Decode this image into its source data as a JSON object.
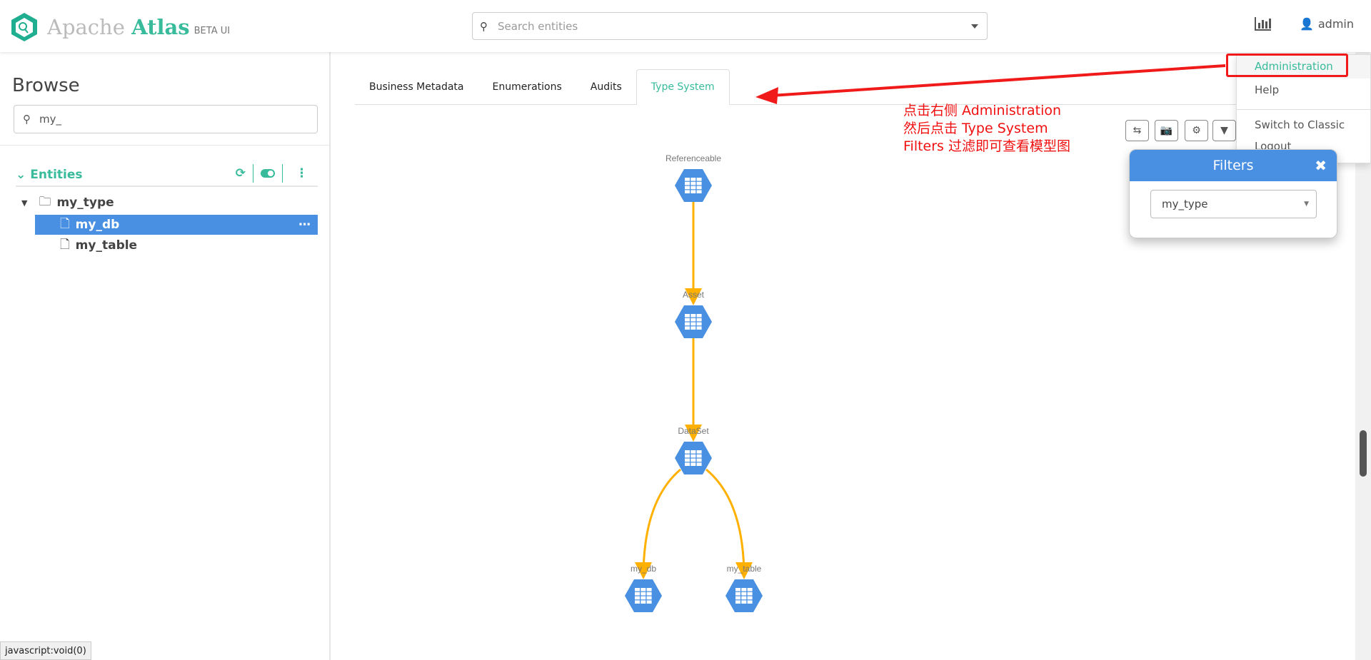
{
  "header": {
    "logo_apache": "Apache",
    "logo_atlas": "Atlas",
    "logo_beta": "BETA UI",
    "search_placeholder": "Search entities",
    "user": "admin"
  },
  "sidebar": {
    "title": "Browse",
    "search_value": "my_",
    "section": "Entities",
    "tree": [
      {
        "label": "my_type",
        "type": "folder"
      },
      {
        "label": "my_db",
        "type": "file",
        "selected": true
      },
      {
        "label": "my_table",
        "type": "file"
      }
    ]
  },
  "tabs": [
    {
      "label": "Business Metadata"
    },
    {
      "label": "Enumerations"
    },
    {
      "label": "Audits"
    },
    {
      "label": "Type System",
      "active": true
    }
  ],
  "user_menu": {
    "items": [
      "Administration",
      "Help",
      "Switch to Classic",
      "Logout"
    ]
  },
  "filters": {
    "title": "Filters",
    "selected": "my_type"
  },
  "graph": {
    "nodes": [
      "Referenceable",
      "Asset",
      "DataSet",
      "my_db",
      "my_table"
    ],
    "edges": [
      [
        "Referenceable",
        "Asset"
      ],
      [
        "Asset",
        "DataSet"
      ],
      [
        "DataSet",
        "my_db"
      ],
      [
        "DataSet",
        "my_table"
      ]
    ],
    "node_color": "#4a90e2",
    "edge_color": "#ffb000"
  },
  "annotation": {
    "lines": [
      "点击右侧 Administration",
      "然后点击 Type System",
      "Filters 过滤即可查看模型图"
    ],
    "color": "#f01010"
  },
  "status_bar": "javascript:void(0)",
  "colors": {
    "accent": "#37bb9b",
    "selection": "#4a90e2"
  }
}
